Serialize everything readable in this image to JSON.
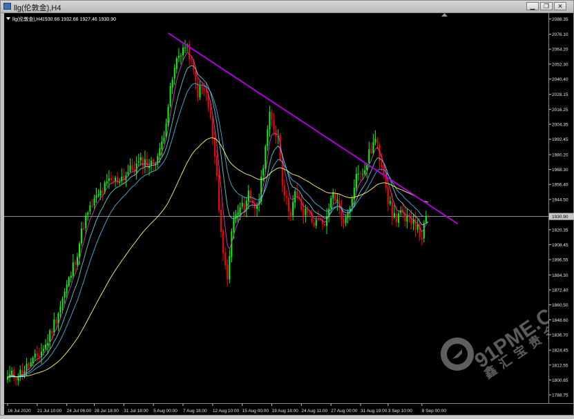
{
  "window": {
    "title": "llg(伦敦金),H4",
    "buttons": {
      "minimize": "▁",
      "restore": "❐",
      "close": "✕"
    }
  },
  "chart_header": {
    "symbol": "llg(伦敦金),H4",
    "ohlc": "1930.66 1932.66 1927.46 1930.90"
  },
  "watermark": {
    "site": "91PME.COM",
    "cn": "鑫汇宝贵金属"
  },
  "colors": {
    "background": "#000000",
    "bull": "#00ff00",
    "bear": "#ff0000",
    "trendline": "#b000d8",
    "ma_yellow": "#ffff66",
    "ma_cyan": "#3fb6e8",
    "ma_teal": "#5fcfd0",
    "ma_magenta": "#d040c0",
    "price_line": "#c0c0c0"
  },
  "chart_data": {
    "type": "candlestick",
    "timeframe": "H4",
    "ylim": [
      1782.2,
      2092.9
    ],
    "y_ticks": [
      "2088.35",
      "2076.10",
      "2064.20",
      "2052.30",
      "2040.40",
      "2028.15",
      "2016.25",
      "2004.35",
      "1992.45",
      "1980.20",
      "1968.30",
      "1956.40",
      "1944.50",
      "1932.60",
      "1920.35",
      "1908.45",
      "1896.55",
      "1884.30",
      "1872.40",
      "1860.50",
      "1848.60",
      "1836.70",
      "1824.45",
      "1812.55",
      "1800.65",
      "1788.75"
    ],
    "x_ticks": [
      "16 Jul 2020",
      "21 Jul 10:00",
      "24 Jul 06:00",
      "28 Jul 18:00",
      "31 Jul 18:00",
      "5 Aug 00:00",
      "7 Aug 18:00",
      "12 Aug 10:00",
      "15 Aug 00:00",
      "19 Aug 18:00",
      "24 Aug 11:00",
      "27 Aug 00:00",
      "31 Aug 19:00",
      "3 Sep 10:00",
      "8 Sep 00:00"
    ],
    "current_price": "1930.90",
    "close_path_anchors": [
      [
        0,
        1803
      ],
      [
        6,
        1806
      ],
      [
        12,
        1815
      ],
      [
        18,
        1828
      ],
      [
        22,
        1846
      ],
      [
        26,
        1865
      ],
      [
        30,
        1885
      ],
      [
        33,
        1903
      ],
      [
        36,
        1925
      ],
      [
        40,
        1940
      ],
      [
        44,
        1950
      ],
      [
        48,
        1958
      ],
      [
        52,
        1960
      ],
      [
        56,
        1965
      ],
      [
        60,
        1970
      ],
      [
        64,
        1975
      ],
      [
        68,
        1972
      ],
      [
        72,
        1982
      ],
      [
        74,
        1998
      ],
      [
        76,
        2020
      ],
      [
        78,
        2040
      ],
      [
        80,
        2055
      ],
      [
        82,
        2063
      ],
      [
        84,
        2066
      ],
      [
        86,
        2060
      ],
      [
        88,
        2045
      ],
      [
        90,
        2030
      ],
      [
        92,
        2033
      ],
      [
        94,
        2028
      ],
      [
        96,
        2008
      ],
      [
        98,
        1978
      ],
      [
        100,
        1940
      ],
      [
        102,
        1900
      ],
      [
        104,
        1883
      ],
      [
        106,
        1920
      ],
      [
        108,
        1935
      ],
      [
        110,
        1942
      ],
      [
        112,
        1932
      ],
      [
        114,
        1948
      ],
      [
        116,
        1943
      ],
      [
        118,
        1935
      ],
      [
        120,
        1960
      ],
      [
        122,
        1988
      ],
      [
        124,
        2010
      ],
      [
        126,
        2002
      ],
      [
        128,
        1995
      ],
      [
        130,
        1960
      ],
      [
        132,
        1942
      ],
      [
        134,
        1935
      ],
      [
        136,
        1948
      ],
      [
        138,
        1942
      ],
      [
        140,
        1932
      ],
      [
        142,
        1935
      ],
      [
        144,
        1928
      ],
      [
        146,
        1925
      ],
      [
        148,
        1932
      ],
      [
        150,
        1920
      ],
      [
        152,
        1935
      ],
      [
        154,
        1950
      ],
      [
        156,
        1942
      ],
      [
        158,
        1930
      ],
      [
        160,
        1928
      ],
      [
        162,
        1940
      ],
      [
        164,
        1958
      ],
      [
        166,
        1968
      ],
      [
        168,
        1962
      ],
      [
        170,
        1975
      ],
      [
        172,
        1985
      ],
      [
        174,
        1992
      ],
      [
        176,
        1978
      ],
      [
        178,
        1968
      ],
      [
        180,
        1945
      ],
      [
        182,
        1932
      ],
      [
        184,
        1930
      ],
      [
        186,
        1935
      ],
      [
        188,
        1925
      ],
      [
        190,
        1928
      ],
      [
        192,
        1930
      ],
      [
        194,
        1920
      ],
      [
        196,
        1915
      ],
      [
        198,
        1928
      ],
      [
        199,
        1931
      ]
    ],
    "trendline": {
      "start": {
        "bar": 76,
        "price": 2077
      },
      "end": {
        "bar": 213,
        "price": 1925
      }
    },
    "moving_averages": [
      {
        "color_key": "ma_magenta",
        "period": 5
      },
      {
        "color_key": "ma_teal",
        "period": 10
      },
      {
        "color_key": "ma_cyan",
        "period": 18
      },
      {
        "color_key": "ma_yellow",
        "period": 55
      }
    ]
  }
}
